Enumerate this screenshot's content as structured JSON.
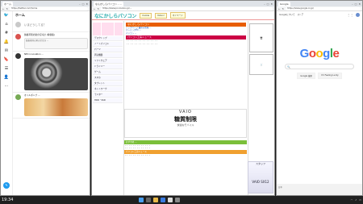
{
  "taskbar": {
    "clock": "19:34"
  },
  "twitter": {
    "tab": "ホーム",
    "url": "https://twitter.com/home",
    "home_title": "ホーム",
    "compose_placeholder": "いまどうしてる？",
    "posts": [
      {
        "text": "価格帯別の夏の空冷計 (特価版)",
        "card": "価格帯別の夏の空冷計 ..."
      },
      {
        "text": "NEC innovation ...",
        "card": ""
      },
      {
        "text": "オイルポンプ ...",
        "card": ""
      }
    ]
  },
  "nanka": {
    "tab": "なんかしらパソコン - ...",
    "url": "https://www.pc-koubou.jp/...",
    "logo_main": "なにかしら",
    "logo_sub": "パソコン",
    "header_buttons": [
      "Cookie",
      "Yahoo!",
      "マイページ"
    ],
    "left_items": [
      "デスクトップ",
      "ノートパソコン",
      "パーツ",
      "周辺機器",
      "ソフトウェア",
      "ドライバー",
      "ゲーム",
      "スマホ",
      "タブレット",
      "ネットワーク",
      "モニター",
      "HDD・SSD"
    ],
    "main_bar": "なにかしらパソコン",
    "main_lines": [
      "トップページ 最新の情報 ...",
      "ゲーミングPC ...",
      "パソコン ..."
    ],
    "orange_bar": "パソコン工房ニュース",
    "green_bar": "おすすめ ...",
    "vaio_logo": "VAIO",
    "vaio_title": "糖質制限",
    "vaio_sub": "快適なモバイル",
    "vaio_model": "VAIO SX12",
    "side_ad": "スタッフ"
  },
  "google": {
    "tab": "Google",
    "url": "https://www.google.co.jp/",
    "top_links": [
      "Googleについて",
      "ストア"
    ],
    "logo": "Google",
    "search_placeholder": "",
    "btn_search": "Google 検索",
    "btn_lucky": "I'm Feeling Lucky",
    "footer": "日本"
  }
}
